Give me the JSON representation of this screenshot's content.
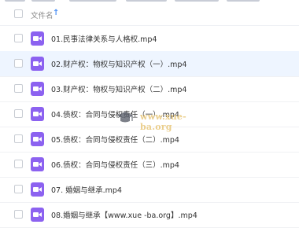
{
  "header": {
    "title": "文件名",
    "sort_icon": "arrow-up-icon"
  },
  "files": [
    {
      "name": "01.民事法律关系与人格权.mp4",
      "icon": "video-file-icon",
      "selected": false
    },
    {
      "name": "02.财产权：物权与知识产权（一）.mp4",
      "icon": "video-file-icon",
      "selected": true
    },
    {
      "name": "03.财产权：物权与知识产权（二）.mp4",
      "icon": "video-file-icon",
      "selected": false
    },
    {
      "name": "04.债权：合同与侵权责任（一）.mp4",
      "icon": "video-file-icon",
      "selected": false
    },
    {
      "name": "05.债权：合同与侵权责任（二）.mp4",
      "icon": "video-file-icon",
      "selected": false
    },
    {
      "name": "06.债权：合同与侵权责任（三）.mp4",
      "icon": "video-file-icon",
      "selected": false
    },
    {
      "name": "07. 婚姻与继承.mp4",
      "icon": "video-file-icon",
      "selected": false
    },
    {
      "name": "08.婚姻与继承【www.xue -ba.org】.mp4",
      "icon": "video-file-icon",
      "selected": false
    }
  ],
  "watermark": {
    "text": "www.xue-ba.org"
  },
  "colors": {
    "accent": "#4a8ff5",
    "video_icon": "#8c62f0",
    "selected_row": "#eef5ff"
  }
}
